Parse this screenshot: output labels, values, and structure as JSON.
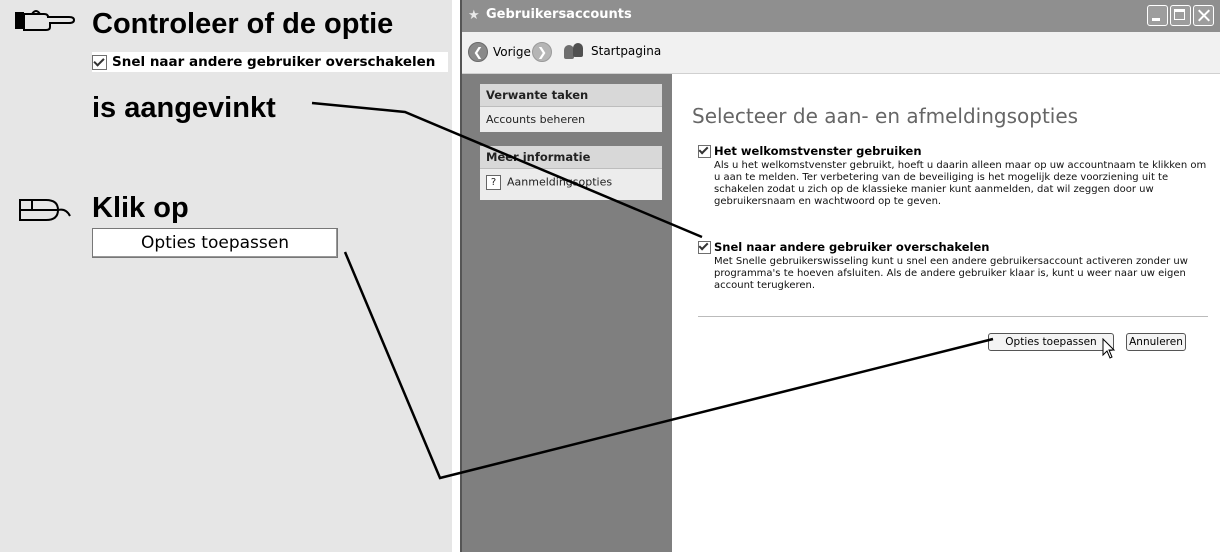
{
  "instructions": {
    "step1_line1": "Controleer of de optie",
    "step1_checkbox_label": "Snel naar andere gebruiker overschakelen",
    "step1_line3": "is aangevinkt",
    "step2_line1": "Klik op",
    "step2_button_label": "Opties toepassen"
  },
  "window": {
    "title": "Gebruikersaccounts",
    "nav": {
      "back": "Vorige",
      "home": "Startpagina"
    },
    "sidebar": {
      "related_head": "Verwante taken",
      "related_item": "Accounts beheren",
      "info_head": "Meer informatie",
      "info_item": "Aanmeldingsopties"
    },
    "heading": "Selecteer de aan- en afmeldingsopties",
    "options": [
      {
        "label": "Het welkomstvenster gebruiken",
        "checked": true,
        "description": "Als u het welkomstvenster gebruikt, hoeft u daarin alleen maar op uw accountnaam te klikken om u aan te melden. Ter verbetering van de beveiliging is het mogelijk deze voorziening uit te schakelen zodat u zich op de klassieke manier kunt aanmelden, dat wil zeggen door uw gebruikersnaam en wachtwoord op te geven."
      },
      {
        "label": "Snel naar andere gebruiker overschakelen",
        "checked": true,
        "description": "Met Snelle gebruikerswisseling kunt u snel een andere gebruikersaccount activeren zonder uw programma's te hoeven afsluiten. Als de andere gebruiker klaar is, kunt u weer naar uw eigen account terugkeren."
      }
    ],
    "buttons": {
      "apply": "Opties toepassen",
      "cancel": "Annuleren"
    }
  }
}
